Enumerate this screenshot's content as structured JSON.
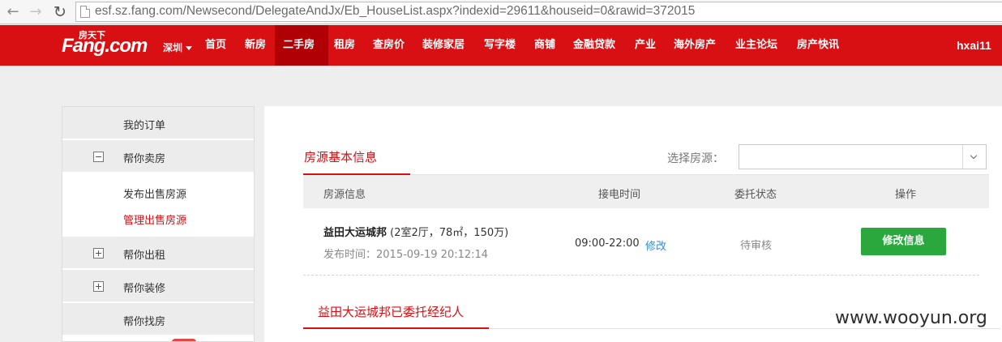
{
  "browser": {
    "url": "esf.sz.fang.com/Newsecond/DelegateAndJx/Eb_HouseList.aspx?indexid=29611&houseid=0&rawid=372015",
    "back_icon": "arrow-left-icon",
    "forward_icon": "arrow-right-icon",
    "reload_icon": "reload-icon"
  },
  "site": {
    "logo_sub": "房天下",
    "logo_main": "Fang.com",
    "city": "深圳",
    "nav": [
      "首页",
      "新房",
      "二手房",
      "租房",
      "查房价",
      "装修家居",
      "写字楼",
      "商铺",
      "金融贷款",
      "产业",
      "海外房产",
      "业主论坛",
      "房产快讯"
    ],
    "active_nav": "二手房",
    "user": "hxai11"
  },
  "sidebar": {
    "my_orders": "我的订单",
    "sell": "帮你卖房",
    "sell_sub": [
      "发布出售房源",
      "管理出售房源"
    ],
    "active_sub": "管理出售房源",
    "rent": "帮你出租",
    "decorate": "帮你装修",
    "find": "帮你找房"
  },
  "main": {
    "tab_title": "房源基本信息",
    "select_label": "选择房源：",
    "select_value": "",
    "columns": [
      "房源信息",
      "接电时间",
      "委托状态",
      "操作"
    ],
    "row": {
      "name": "益田大运城邦",
      "detail": "(2室2厅，78㎡，150万)",
      "date": "发布时间：2015-09-19 20:12:14",
      "time": "09:00-22:00",
      "edit_link": "修改",
      "status": "待审核",
      "action": "修改信息"
    },
    "agent_title": "益田大运城邦已委托经纪人"
  },
  "watermark": "www.wooyun.org",
  "colors": {
    "brand_red": "#d80f13",
    "active_nav_bg": "#b10005",
    "action_green": "#2aa83e",
    "link_blue": "#3a8ad8"
  }
}
